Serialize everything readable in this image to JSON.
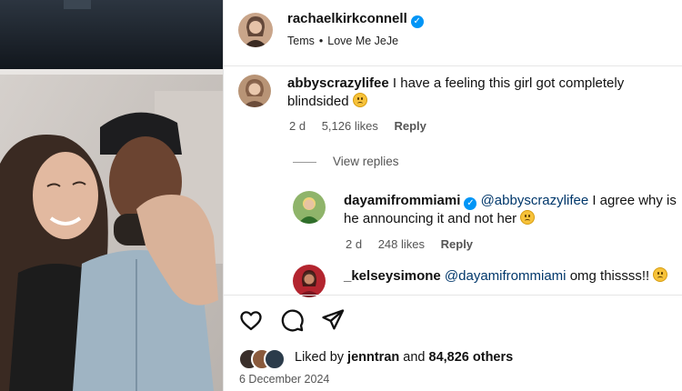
{
  "post": {
    "author": "rachaelkirkconnell",
    "verified": true,
    "audio": {
      "artist": "Tems",
      "track": "Love Me JeJe",
      "separator": "•"
    }
  },
  "comments": [
    {
      "username": "abbyscrazylifee",
      "text": "I have a feeling this girl got completely blindsided",
      "emoji": "sad-face",
      "time": "2 d",
      "likes": "5,126 likes",
      "reply": "Reply"
    }
  ],
  "view_replies": "View replies",
  "replies": [
    {
      "username": "dayamifrommiami",
      "verified": true,
      "mention": "@abbyscrazylifee",
      "text": "I agree why is he announcing it and not her",
      "emoji": "sad-face",
      "time": "2 d",
      "likes": "248 likes",
      "reply": "Reply"
    },
    {
      "username": "_kelseysimone",
      "mention": "@dayamifrommiami",
      "text": "omg thissss!!",
      "emoji": "sad-face"
    }
  ],
  "actions": {
    "like_icon": "heart-icon",
    "comment_icon": "comment-icon",
    "share_icon": "send-icon"
  },
  "likes": {
    "prefix": "Liked by",
    "user": "jenntran",
    "joiner": "and",
    "others": "84,826 others"
  },
  "date": "6 December 2024",
  "colors": {
    "verified": "#0095f6",
    "mention": "#00376b",
    "meta": "#555555"
  }
}
